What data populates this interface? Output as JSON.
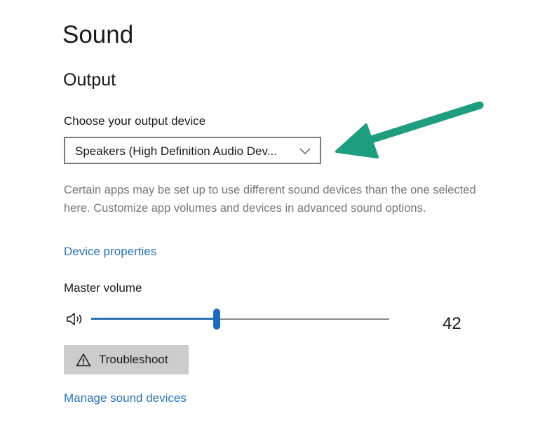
{
  "header": {
    "title": "Sound"
  },
  "output": {
    "section_title": "Output",
    "device_label": "Choose your output device",
    "device_selected": "Speakers (High Definition Audio Dev...",
    "description": "Certain apps may be set up to use different sound devices than the one selected here. Customize app volumes and devices in advanced sound options.",
    "device_properties_link": "Device properties"
  },
  "volume": {
    "label": "Master volume",
    "value": 42,
    "value_text": "42"
  },
  "actions": {
    "troubleshoot_label": "Troubleshoot",
    "manage_devices_link": "Manage sound devices"
  },
  "icons": {
    "speaker": "speaker-volume-icon",
    "chevron": "chevron-down-icon",
    "warning": "warning-icon",
    "annotation_arrow": "annotation-arrow"
  },
  "colors": {
    "link": "#2b75b6",
    "slider_fill": "#2b6fb3",
    "slider_thumb": "#1e6ac0",
    "annotation_arrow": "#1f9e7f",
    "button_bg": "#cccccc",
    "description_text": "#777777"
  }
}
